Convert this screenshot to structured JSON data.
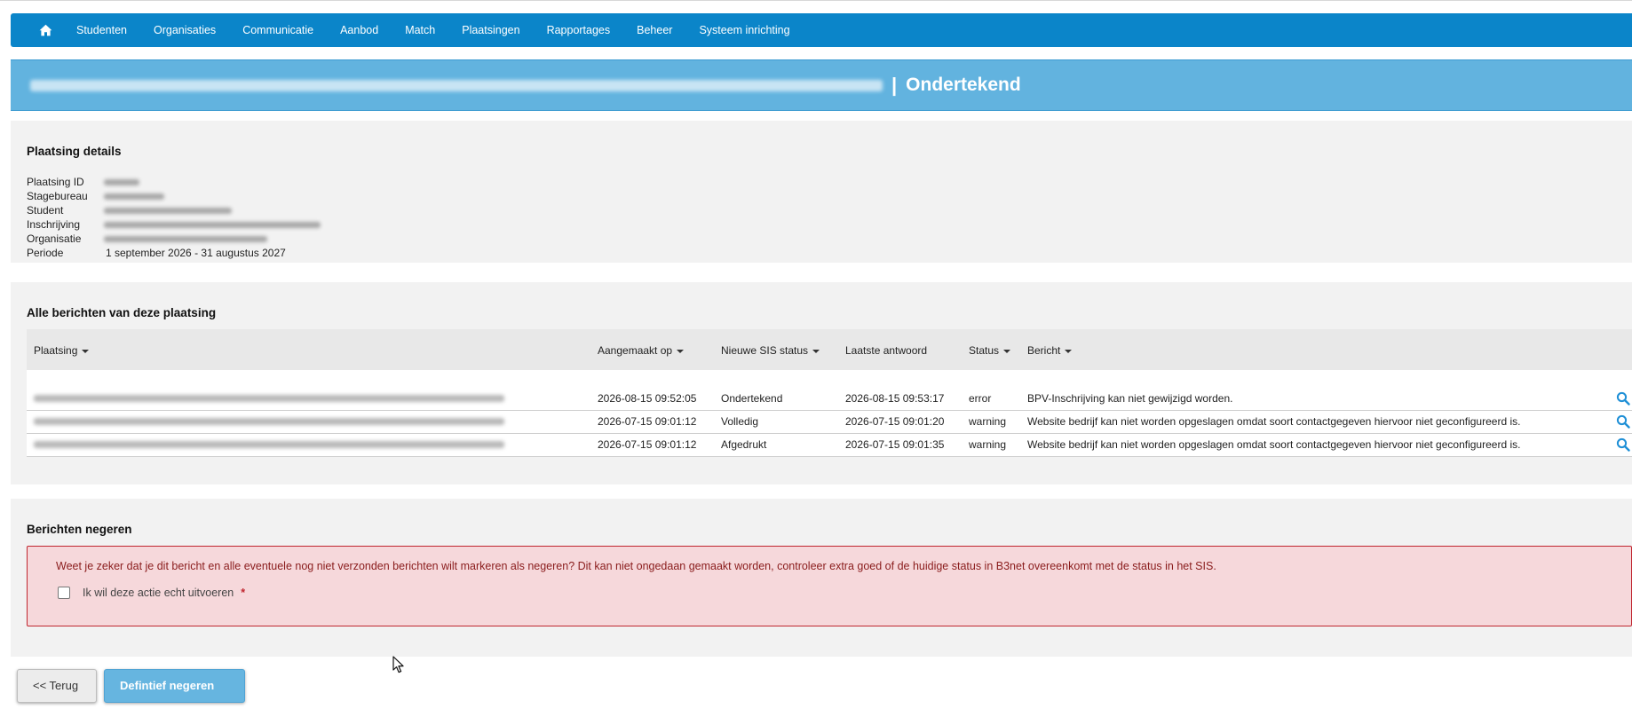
{
  "nav": {
    "items": [
      "Studenten",
      "Organisaties",
      "Communicatie",
      "Aanbod",
      "Match",
      "Plaatsingen",
      "Rapportages",
      "Beheer",
      "Systeem inrichting"
    ]
  },
  "banner": {
    "separator": "|",
    "status": "Ondertekend"
  },
  "details": {
    "title": "Plaatsing details",
    "labels": {
      "plaatsing_id": "Plaatsing ID",
      "stagebureau": "Stagebureau",
      "student": "Student",
      "inschrijving": "Inschrijving",
      "organisatie": "Organisatie",
      "periode": "Periode"
    },
    "periode_value": "1 september 2026 - 31 augustus 2027"
  },
  "messages": {
    "title": "Alle berichten van deze plaatsing",
    "columns": {
      "plaatsing": "Plaatsing",
      "aangemaakt_op": "Aangemaakt op",
      "nieuwe_sis_status": "Nieuwe SIS status",
      "laatste_antwoord": "Laatste antwoord",
      "status": "Status",
      "bericht": "Bericht"
    },
    "rows": [
      {
        "aangemaakt_op": "2026-08-15 09:52:05",
        "nieuwe_sis_status": "Ondertekend",
        "laatste_antwoord": "2026-08-15 09:53:17",
        "status": "error",
        "bericht": "BPV-Inschrijving kan niet gewijzigd worden."
      },
      {
        "aangemaakt_op": "2026-07-15 09:01:12",
        "nieuwe_sis_status": "Volledig",
        "laatste_antwoord": "2026-07-15 09:01:20",
        "status": "warning",
        "bericht": "Website bedrijf kan niet worden opgeslagen omdat soort contactgegeven hiervoor niet geconfigureerd is."
      },
      {
        "aangemaakt_op": "2026-07-15 09:01:12",
        "nieuwe_sis_status": "Afgedrukt",
        "laatste_antwoord": "2026-07-15 09:01:35",
        "status": "warning",
        "bericht": "Website bedrijf kan niet worden opgeslagen omdat soort contactgegeven hiervoor niet geconfigureerd is."
      }
    ]
  },
  "ignore": {
    "title": "Berichten negeren",
    "warning": "Weet je zeker dat je dit bericht en alle eventuele nog niet verzonden berichten wilt markeren als negeren? Dit kan niet ongedaan gemaakt worden, controleer extra goed of de huidige status in B3net overeenkomt met de status in het SIS.",
    "checkbox_label": "Ik wil deze actie echt uitvoeren",
    "required_mark": "*"
  },
  "buttons": {
    "back": "<< Terug",
    "ignore": "Defintief negeren"
  },
  "colors": {
    "navbar": "#0b85c9",
    "banner": "#62b3df",
    "alert_bg": "#f6d8db",
    "alert_border": "#c0262f",
    "primary_button": "#66b5e0"
  },
  "icons": {
    "home": "home-icon",
    "view": "magnifier-icon",
    "sort": "caret-down-icon"
  }
}
